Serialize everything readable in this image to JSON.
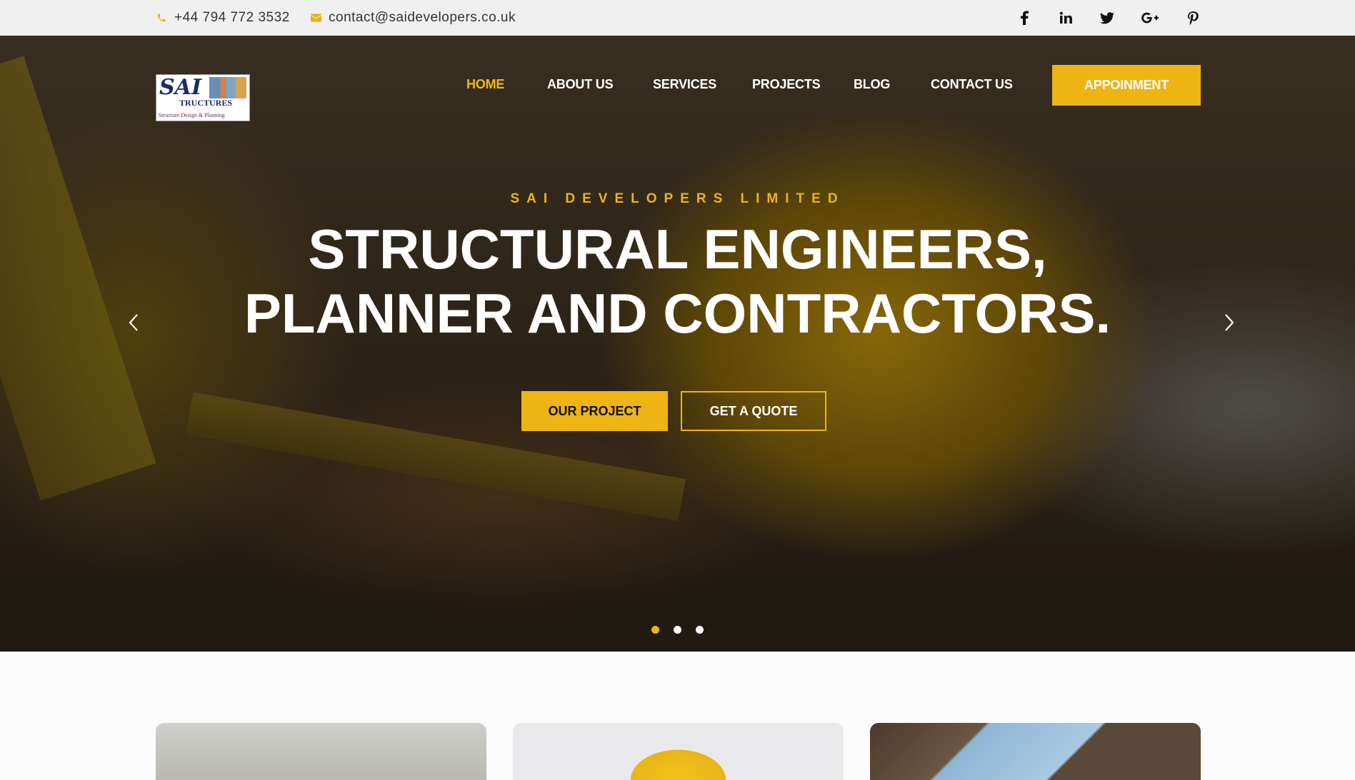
{
  "topbar": {
    "phone": "+44 794 772 3532",
    "email": "contact@saidevelopers.co.uk",
    "phone_icon": "phone-icon",
    "email_icon": "envelope-icon",
    "social": [
      {
        "name": "facebook-icon",
        "glyph": "f"
      },
      {
        "name": "linkedin-icon",
        "glyph": "in"
      },
      {
        "name": "twitter-icon",
        "glyph": "twitter"
      },
      {
        "name": "google-plus-icon",
        "glyph": "G+"
      },
      {
        "name": "pinterest-icon",
        "glyph": "P"
      }
    ]
  },
  "logo": {
    "line1": "SAI",
    "line2": "TRUCTURES",
    "tagline": "Structure Design & Planning"
  },
  "nav": {
    "items": [
      "HOME",
      "ABOUT US",
      "SERVICES",
      "PROJECTS",
      "BLOG",
      "CONTACT US"
    ],
    "active": "HOME",
    "cta": "APPOINMENT"
  },
  "hero": {
    "eyebrow": "SAI DEVELOPERS LIMITED",
    "headline_line1": "STRUCTURAL ENGINEERS,",
    "headline_line2": "PLANNER AND CONTRACTORS.",
    "primary_button": "OUR PROJECT",
    "secondary_button": "GET A QUOTE",
    "slides_total": 3,
    "active_slide": 1
  },
  "colors": {
    "accent": "#eeb414",
    "topbar_bg": "#f0f0f0",
    "text_dark": "#111111"
  }
}
